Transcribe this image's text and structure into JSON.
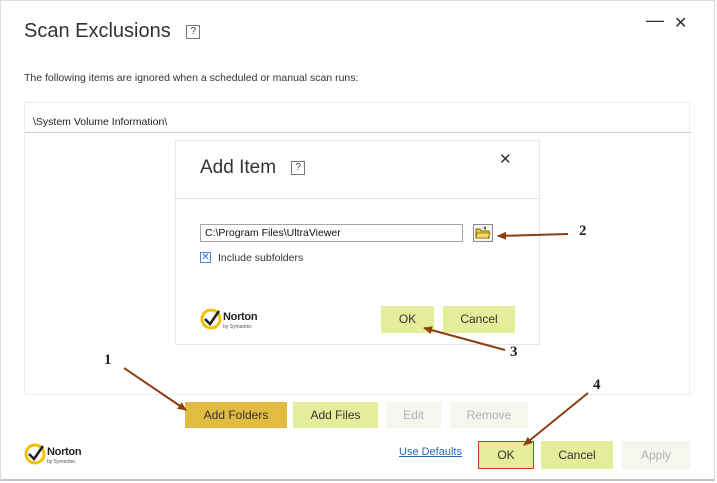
{
  "window": {
    "title": "Scan Exclusions",
    "help_glyph": "?",
    "minimize_glyph": "—",
    "close_glyph": "✕"
  },
  "subtitle": "The following items are ignored when a scheduled or manual scan runs:",
  "list": {
    "items": [
      "\\System Volume Information\\"
    ]
  },
  "buttons": {
    "add_folders": "Add Folders",
    "add_files": "Add Files",
    "edit": "Edit",
    "remove": "Remove",
    "use_defaults": "Use Defaults",
    "ok": "OK",
    "cancel": "Cancel",
    "apply": "Apply"
  },
  "dialog": {
    "title": "Add Item",
    "help_glyph": "?",
    "close_glyph": "✕",
    "path_value": "C:\\Program Files\\UltraViewer",
    "include_subfolders_label": "Include subfolders",
    "include_subfolders_checked": true,
    "ok": "OK",
    "cancel": "Cancel"
  },
  "brand": {
    "name": "Norton",
    "sub": "by Symantec"
  },
  "annotations": [
    "1",
    "2",
    "3",
    "4"
  ],
  "colors": {
    "primary_button": "#e4ee9a",
    "highlight_button": "#e2bb41",
    "arrow": "#8b3f10",
    "ok_highlight_border": "#c0392b"
  }
}
